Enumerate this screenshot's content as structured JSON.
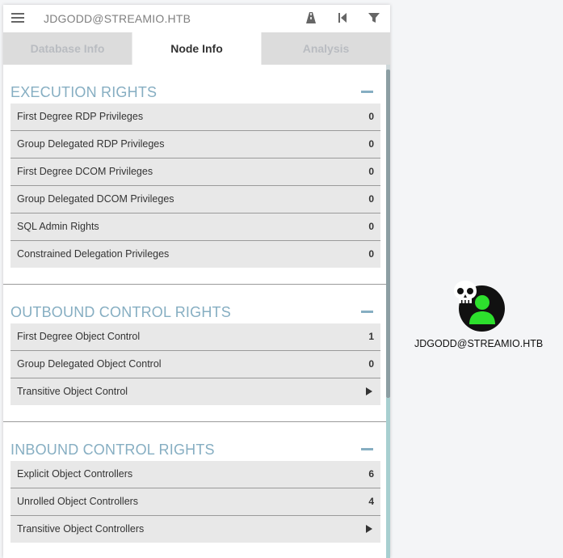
{
  "header": {
    "search_text": "JDGODD@STREAMIO.HTB",
    "icons": [
      "menu-icon",
      "pathfinding-icon",
      "back-icon",
      "filter-icon"
    ]
  },
  "tabs": [
    {
      "label": "Database Info",
      "active": false
    },
    {
      "label": "Node Info",
      "active": true
    },
    {
      "label": "Analysis",
      "active": false
    }
  ],
  "sections": [
    {
      "title": "EXECUTION RIGHTS",
      "rows": [
        {
          "label": "First Degree RDP Privileges",
          "value": "0"
        },
        {
          "label": "Group Delegated RDP Privileges",
          "value": "0"
        },
        {
          "label": "First Degree DCOM Privileges",
          "value": "0"
        },
        {
          "label": "Group Delegated DCOM Privileges",
          "value": "0"
        },
        {
          "label": "SQL Admin Rights",
          "value": "0"
        },
        {
          "label": "Constrained Delegation Privileges",
          "value": "0"
        }
      ]
    },
    {
      "title": "OUTBOUND CONTROL RIGHTS",
      "rows": [
        {
          "label": "First Degree Object Control",
          "value": "1"
        },
        {
          "label": "Group Delegated Object Control",
          "value": "0"
        },
        {
          "label": "Transitive Object Control",
          "value": ""
        }
      ]
    },
    {
      "title": "INBOUND CONTROL RIGHTS",
      "rows": [
        {
          "label": "Explicit Object Controllers",
          "value": "6"
        },
        {
          "label": "Unrolled Object Controllers",
          "value": "4"
        },
        {
          "label": "Transitive Object Controllers",
          "value": ""
        }
      ]
    }
  ],
  "graph_node": {
    "label": "JDGODD@STREAMIO.HTB",
    "icon": "user-owned-skull-icon",
    "colors": {
      "circle": "#111111",
      "user": "#2de02d",
      "skull": "#ffffff"
    }
  },
  "colors": {
    "section_title": "#86aec2",
    "row_bg": "#e8e8e8",
    "tab_inactive_bg": "#dcdcdc"
  }
}
